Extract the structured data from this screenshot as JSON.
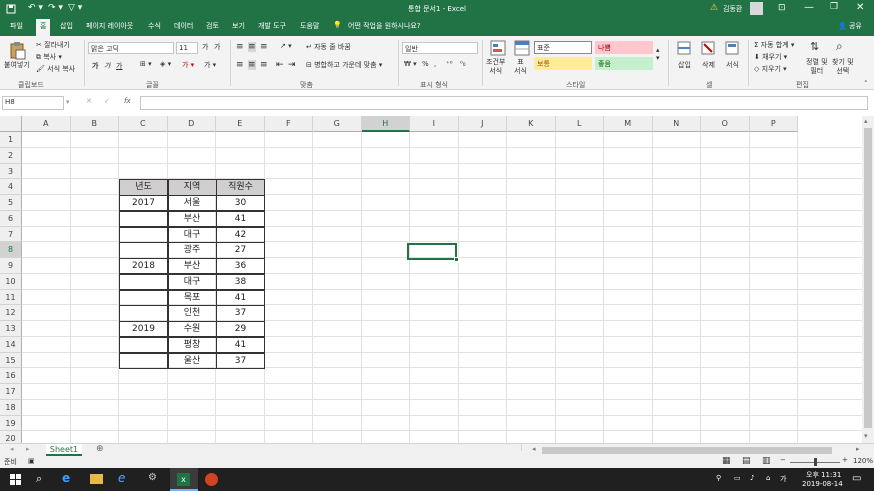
{
  "window": {
    "title": "통합 문서1  -  Excel",
    "user": "김동환"
  },
  "tabs": [
    {
      "label": "파일"
    },
    {
      "label": "홈"
    },
    {
      "label": "삽입"
    },
    {
      "label": "페이지 레이아웃"
    },
    {
      "label": "수식"
    },
    {
      "label": "데이터"
    },
    {
      "label": "검토"
    },
    {
      "label": "보기"
    },
    {
      "label": "개발 도구"
    },
    {
      "label": "도움말"
    }
  ],
  "tell_me": "어떤 작업을 원하시나요?",
  "share": "공유",
  "ribbon": {
    "clipboard": {
      "paste": "붙여넣기",
      "cut": "잘라내기",
      "copy": "복사",
      "format_painter": "서식 복사",
      "label": "클립보드"
    },
    "font": {
      "name": "맑은 고딕",
      "size": "11",
      "bold": "가",
      "italic": "가",
      "underline": "가",
      "grow": "가",
      "shrink": "가",
      "label": "글꼴"
    },
    "alignment": {
      "wrap": "자동 줄 바꿈",
      "merge": "병합하고 가운데 맞춤",
      "label": "맞춤"
    },
    "number": {
      "format": "일반",
      "label": "표시 형식"
    },
    "styles": {
      "conditional": "조건부\n서식",
      "table": "표\n서식",
      "normal": "표준",
      "bad": "나쁨",
      "neutral": "보통",
      "good": "좋음",
      "label": "스타일"
    },
    "cells": {
      "insert": "삽입",
      "delete": "삭제",
      "format": "서식",
      "label": "셀"
    },
    "editing": {
      "autosum": "자동 합계",
      "fill": "채우기",
      "clear": "지우기",
      "sort": "정렬 및\n필터",
      "find": "찾기 및\n선택",
      "label": "편집"
    }
  },
  "formula_bar": {
    "name_box": "H8",
    "content": ""
  },
  "columns": [
    "A",
    "B",
    "C",
    "D",
    "E",
    "F",
    "G",
    "H",
    "I",
    "J",
    "K",
    "L",
    "M",
    "N",
    "O",
    "P"
  ],
  "rows": [
    "1",
    "2",
    "3",
    "4",
    "5",
    "6",
    "7",
    "8",
    "9",
    "10",
    "11",
    "12",
    "13",
    "14",
    "15",
    "16",
    "17",
    "18",
    "19",
    "20"
  ],
  "table": {
    "headers": [
      "년도",
      "지역",
      "직원수"
    ],
    "rows": [
      [
        "2017",
        "서울",
        "30"
      ],
      [
        "",
        "부산",
        "41"
      ],
      [
        "",
        "대구",
        "42"
      ],
      [
        "",
        "광주",
        "27"
      ],
      [
        "2018",
        "부산",
        "36"
      ],
      [
        "",
        "대구",
        "38"
      ],
      [
        "",
        "목포",
        "41"
      ],
      [
        "",
        "인천",
        "37"
      ],
      [
        "2019",
        "수원",
        "29"
      ],
      [
        "",
        "평창",
        "41"
      ],
      [
        "",
        "울산",
        "37"
      ]
    ]
  },
  "sheet_tabs": [
    "Sheet1"
  ],
  "status": {
    "ready": "준비",
    "zoom": "120%"
  },
  "taskbar": {
    "time": "오후 11:31",
    "date": "2019-08-14",
    "ime": "가"
  }
}
